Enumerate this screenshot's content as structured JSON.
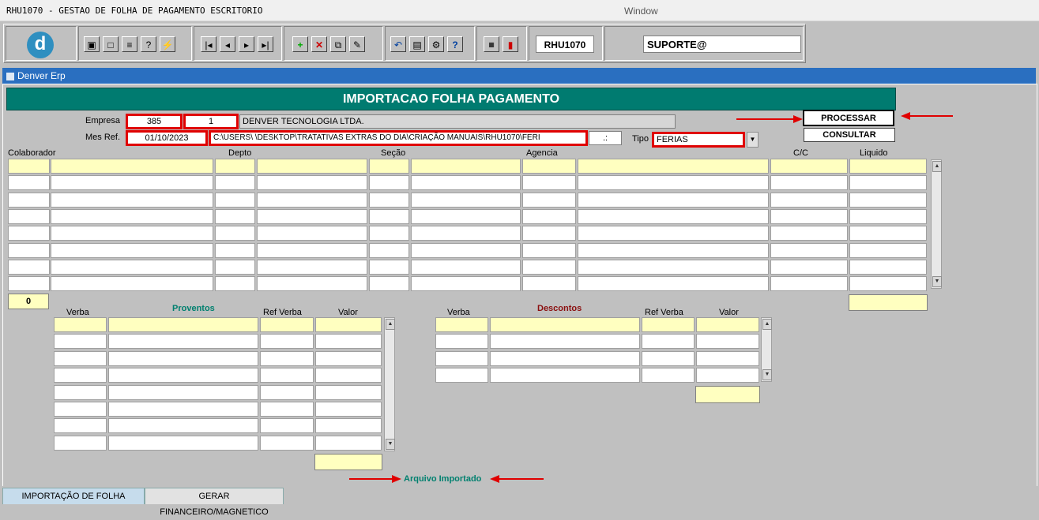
{
  "window": {
    "app_title": "RHU1070 - GESTAO DE FOLHA DE PAGAMENTO ESCRITORIO",
    "menu_title": "Window"
  },
  "toolbar": {
    "logo": "d",
    "form_code": "RHU1070",
    "user": "SUPORTE@"
  },
  "inner_window": {
    "title": "Denver Erp"
  },
  "form": {
    "header": "IMPORTACAO FOLHA PAGAMENTO",
    "empresa_label": "Empresa",
    "empresa_code": "385",
    "empresa_filial": "1",
    "empresa_name": "DENVER TECNOLOGIA LTDA.",
    "mesref_label": "Mes Ref.",
    "mesref_value": "01/10/2023",
    "path_value": "C:\\USERS\\                   \\DESKTOP\\TRATATIVAS EXTRAS DO DIA\\CRIAÇÃO MANUAIS\\RHU1070\\FERI",
    "path_suffix": ".:",
    "tipo_label": "Tipo",
    "tipo_value": "FERIAS",
    "processar_label": "PROCESSAR ARQU...",
    "consultar_label": "CONSULTAR"
  },
  "main_grid": {
    "columns": {
      "colaborador": "Colaborador",
      "depto": "Depto",
      "secao": "Seção",
      "agencia": "Agencia",
      "cc": "C/C",
      "liquido": "Liquido"
    },
    "count": "0"
  },
  "proventos": {
    "title": "Proventos",
    "col_verba": "Verba",
    "col_ref": "Ref Verba",
    "col_valor": "Valor"
  },
  "descontos": {
    "title": "Descontos",
    "col_verba": "Verba",
    "col_ref": "Ref Verba",
    "col_valor": "Valor"
  },
  "status": {
    "arquivo_importado": "Arquivo Importado"
  },
  "tabs": {
    "tab1": "IMPORTAÇÃO DE FOLHA",
    "tab2": "GERAR FINANCEIRO/MAGNETICO"
  }
}
